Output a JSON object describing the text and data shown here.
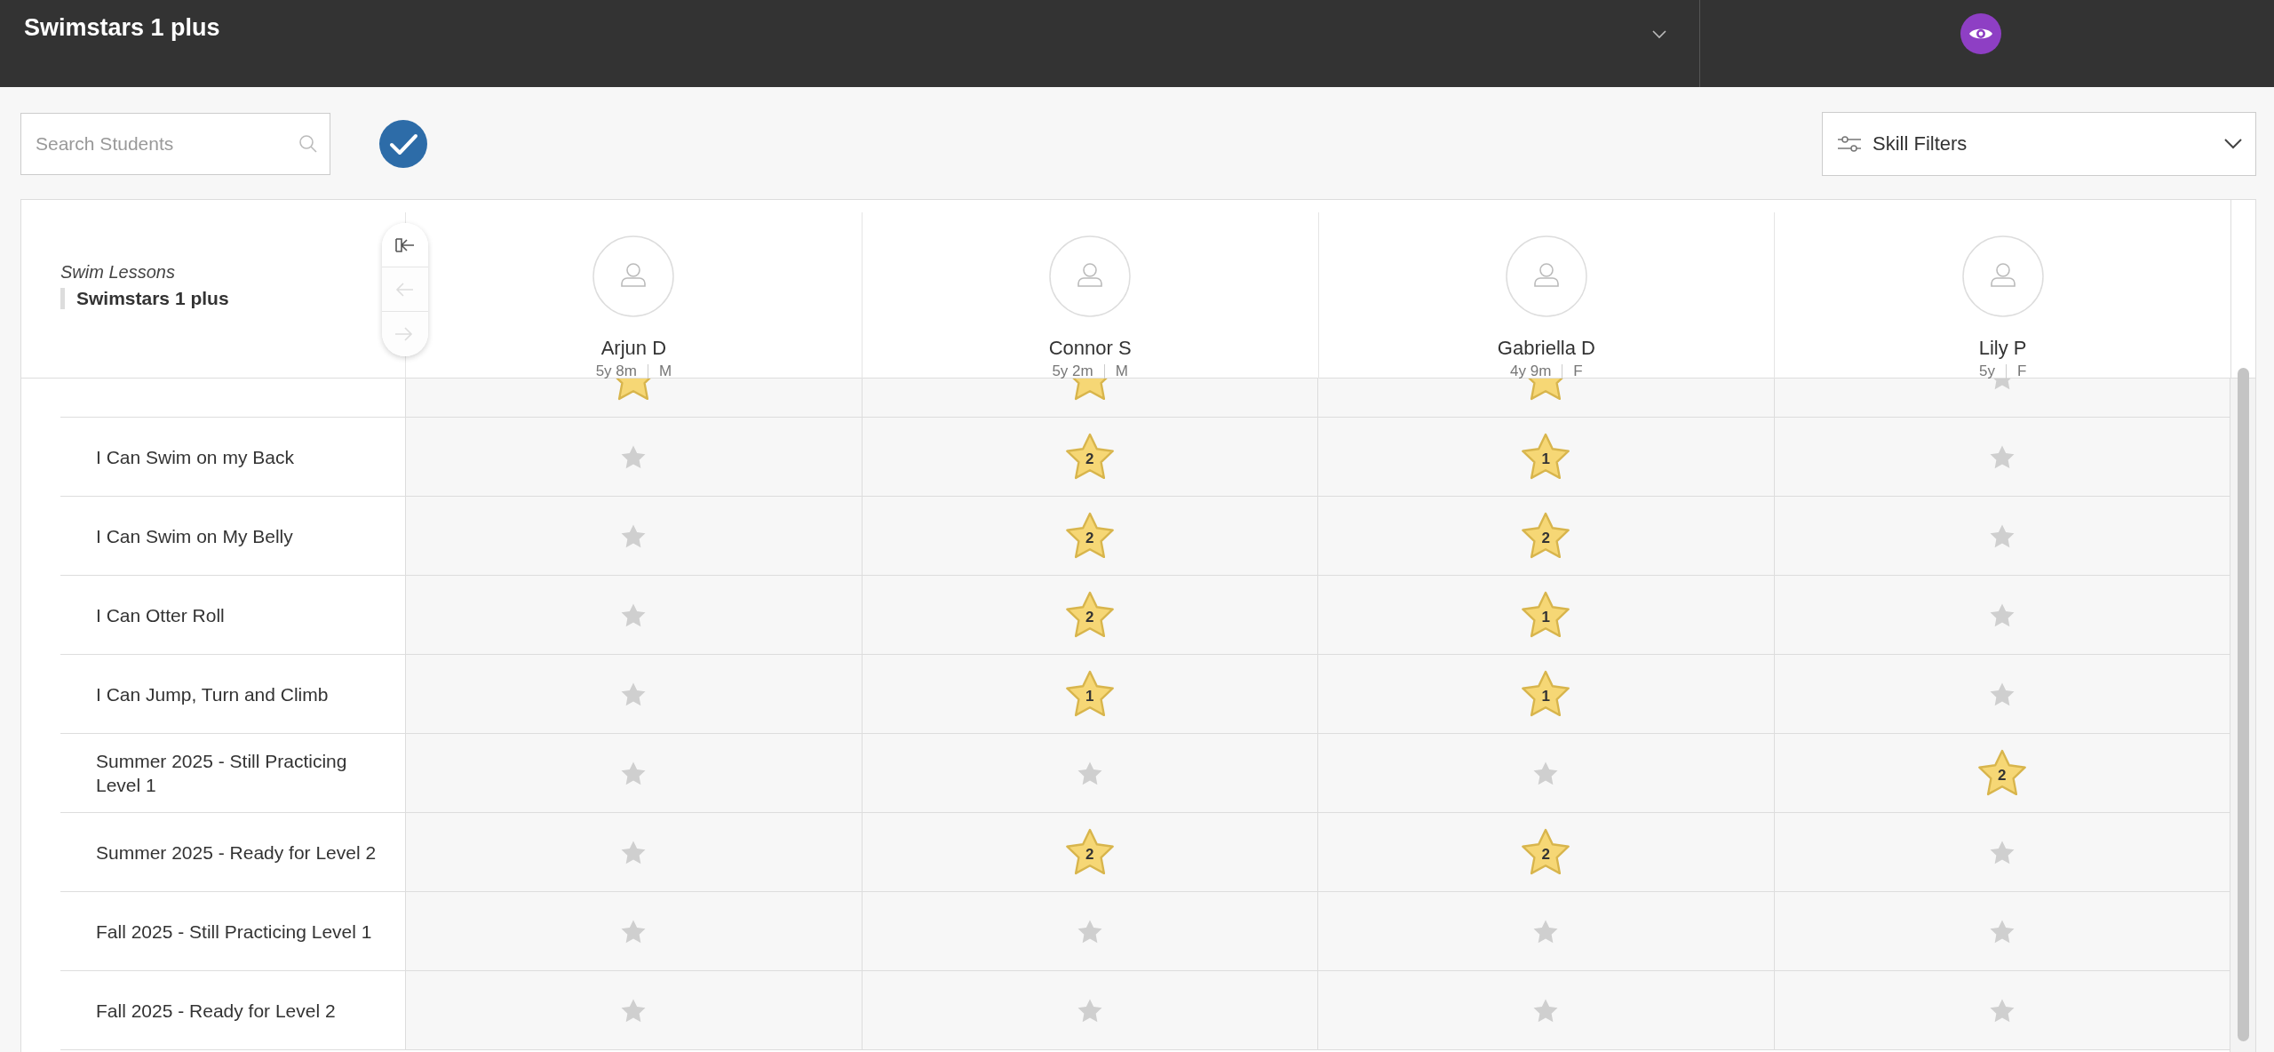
{
  "top_bar": {
    "title": "Swimstars 1 plus"
  },
  "toolbar": {
    "search": {
      "placeholder": "Search Students"
    },
    "filter_button": {
      "label": "Skill Filters"
    }
  },
  "header": {
    "category": "Swim Lessons",
    "class_name": "Swimstars 1 plus"
  },
  "nav_buttons": [
    {
      "kind": "collapse",
      "disabled": false
    },
    {
      "kind": "prev",
      "disabled": true
    },
    {
      "kind": "next",
      "disabled": true
    }
  ],
  "students": [
    {
      "name": "Arjun D",
      "age": "5y 8m",
      "gender": "M"
    },
    {
      "name": "Connor S",
      "age": "5y 2m",
      "gender": "M"
    },
    {
      "name": "Gabriella D",
      "age": "4y 9m",
      "gender": "F"
    },
    {
      "name": "Lily P",
      "age": "5y",
      "gender": "F"
    }
  ],
  "skills": [
    {
      "cells": [
        {
          "awarded": true
        },
        {
          "awarded": true
        },
        {
          "awarded": true
        },
        {
          "awarded": false
        }
      ]
    },
    {
      "label": "I Can Swim on my Back",
      "cells": [
        {
          "awarded": false
        },
        {
          "awarded": true,
          "count": "2"
        },
        {
          "awarded": true,
          "count": "1"
        },
        {
          "awarded": false
        }
      ]
    },
    {
      "label": "I Can Swim on My Belly",
      "cells": [
        {
          "awarded": false
        },
        {
          "awarded": true,
          "count": "2"
        },
        {
          "awarded": true,
          "count": "2"
        },
        {
          "awarded": false
        }
      ]
    },
    {
      "label": "I Can Otter Roll",
      "cells": [
        {
          "awarded": false
        },
        {
          "awarded": true,
          "count": "2"
        },
        {
          "awarded": true,
          "count": "1"
        },
        {
          "awarded": false
        }
      ]
    },
    {
      "label": "I Can Jump, Turn and Climb",
      "cells": [
        {
          "awarded": false
        },
        {
          "awarded": true,
          "count": "1"
        },
        {
          "awarded": true,
          "count": "1"
        },
        {
          "awarded": false
        }
      ]
    },
    {
      "label": "Summer 2025 - Still Practicing Level 1",
      "cells": [
        {
          "awarded": false
        },
        {
          "awarded": false
        },
        {
          "awarded": false
        },
        {
          "awarded": true,
          "count": "2"
        }
      ]
    },
    {
      "label": "Summer 2025 - Ready for Level 2",
      "cells": [
        {
          "awarded": false
        },
        {
          "awarded": true,
          "count": "2"
        },
        {
          "awarded": true,
          "count": "2"
        },
        {
          "awarded": false
        }
      ]
    },
    {
      "label": "Fall 2025 - Still Practicing Level 1",
      "cells": [
        {
          "awarded": false
        },
        {
          "awarded": false
        },
        {
          "awarded": false
        },
        {
          "awarded": false
        }
      ]
    },
    {
      "label": "Fall 2025 - Ready for Level 2",
      "cells": [
        {
          "awarded": false
        },
        {
          "awarded": false
        },
        {
          "awarded": false
        },
        {
          "awarded": false
        }
      ]
    }
  ]
}
